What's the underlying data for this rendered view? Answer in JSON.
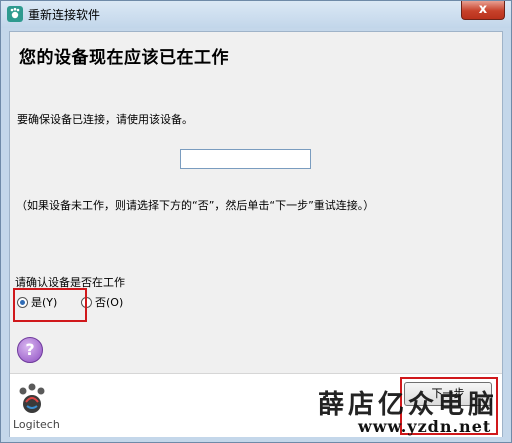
{
  "window": {
    "title": "重新连接软件",
    "close_label": "x"
  },
  "main": {
    "heading": "您的设备现在应该已在工作",
    "instruction": "要确保设备已连接，请使用该设备。",
    "test_field_value": "",
    "hint": "（如果设备未工作，则请选择下方的“否”，然后单击“下一步”重试连接。）",
    "question": "请确认设备是否在工作",
    "options": [
      {
        "label": "是(Y)",
        "checked": true
      },
      {
        "label": "否(O)",
        "checked": false
      }
    ],
    "help_symbol": "?"
  },
  "footer": {
    "logo_text": "Logitech",
    "next_label": "下一步",
    "watermark": "薛店亿众电脑",
    "watermark_url": "www.yzdn.net"
  },
  "colors": {
    "highlight": "#d0181b",
    "accent": "#2e9a8f"
  }
}
